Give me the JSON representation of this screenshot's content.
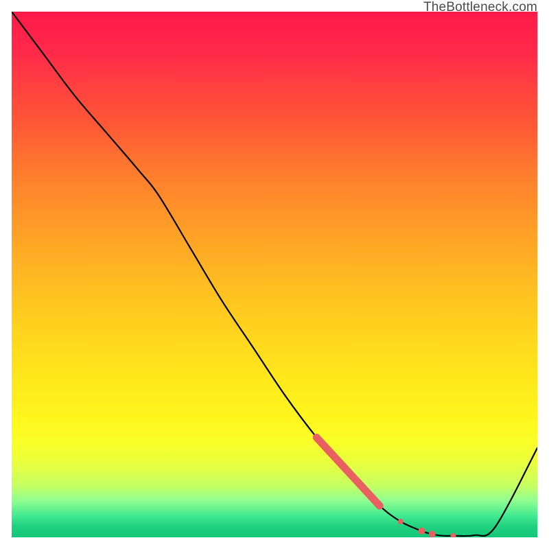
{
  "watermark": "TheBottleneck.com",
  "chart_data": {
    "type": "line",
    "title": "",
    "xlabel": "",
    "ylabel": "",
    "xlim": [
      0,
      100
    ],
    "ylim": [
      0,
      100
    ],
    "curve": {
      "x": [
        0,
        6,
        12,
        18,
        24,
        28,
        34,
        40,
        46,
        52,
        58,
        64,
        70,
        74,
        78,
        80,
        82,
        84,
        88,
        92,
        100
      ],
      "y": [
        100,
        92,
        84,
        77,
        70,
        65,
        55,
        45,
        36,
        27,
        19,
        12,
        6,
        3,
        1.2,
        0.6,
        0.3,
        0.3,
        0.4,
        2,
        17
      ]
    },
    "highlight_segment": {
      "color": "#e86060",
      "thick": {
        "x_start": 58,
        "y_start": 19,
        "x_end": 70,
        "y_end": 6
      },
      "dots": [
        {
          "x": 74,
          "y": 3,
          "r": 4
        },
        {
          "x": 78,
          "y": 1.2,
          "r": 5
        },
        {
          "x": 80,
          "y": 0.6,
          "r": 5
        },
        {
          "x": 84,
          "y": 0.3,
          "r": 4
        }
      ]
    },
    "background": "red-yellow-green vertical gradient"
  }
}
